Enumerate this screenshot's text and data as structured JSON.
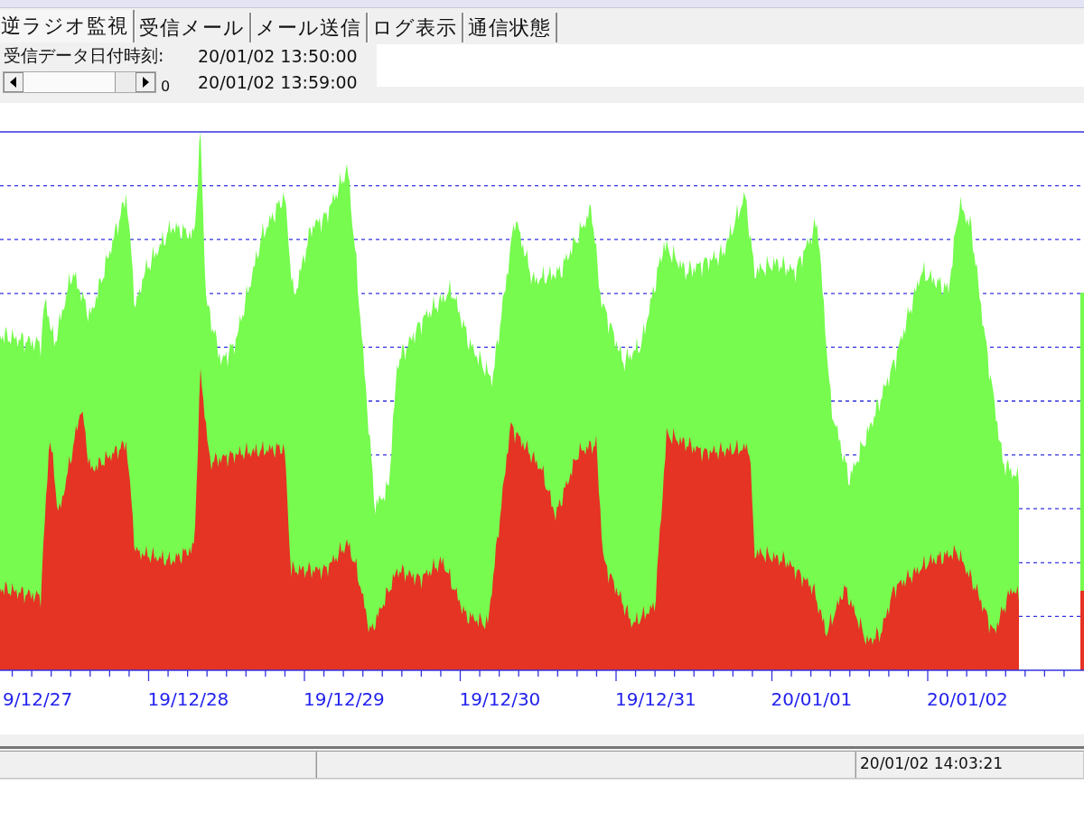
{
  "tabs": [
    {
      "label": "逆ラジオ監視",
      "selected": true
    },
    {
      "label": "受信メール",
      "selected": false
    },
    {
      "label": "メール送信",
      "selected": false
    },
    {
      "label": "ログ表示",
      "selected": false
    },
    {
      "label": "通信状態",
      "selected": false
    }
  ],
  "receive_info": {
    "label": "受信データ日付時刻:",
    "start_time": "20/01/02 13:50:00",
    "end_time": "20/01/02 13:59:00",
    "scroll_value": "0"
  },
  "chart": {
    "x_labels": [
      "9/12/27",
      "19/12/28",
      "19/12/29",
      "19/12/30",
      "19/12/31",
      "20/01/01",
      "20/01/02"
    ]
  },
  "status_bar": {
    "timestamp": "20/01/02 14:03:21"
  }
}
